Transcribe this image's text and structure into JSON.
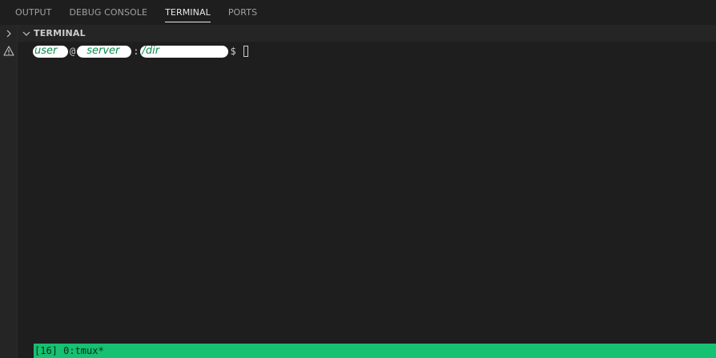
{
  "tabs": [
    {
      "label": "OUTPUT"
    },
    {
      "label": "DEBUG CONSOLE"
    },
    {
      "label": "TERMINAL"
    },
    {
      "label": "PORTS"
    }
  ],
  "active_tab": "TERMINAL",
  "section": {
    "title": "TERMINAL"
  },
  "left_strip": {
    "icons": [
      "chevron-right-icon",
      "warning-icon"
    ]
  },
  "prompt": {
    "user": "user",
    "at": "@",
    "server": "server",
    "colon": ":",
    "path": "/dir",
    "symbol": "$"
  },
  "tmux": {
    "status": "[16] 0:tmux*"
  },
  "colors": {
    "tmux_bar": "#16c172",
    "scribble": "#0d8a4e",
    "background": "#1e1e1e"
  }
}
